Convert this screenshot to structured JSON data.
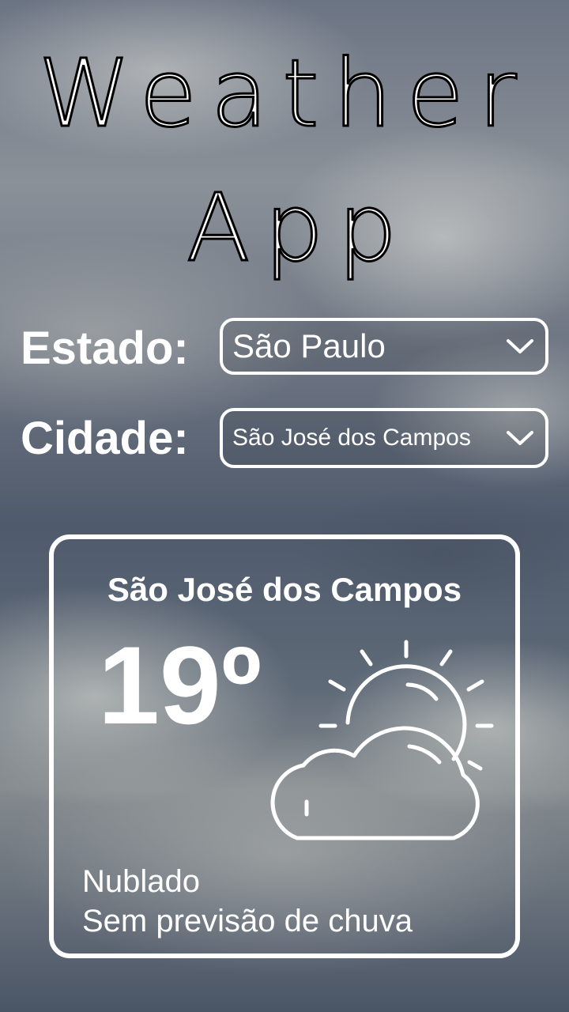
{
  "app": {
    "title_line1": "Weather",
    "title_line2": "App"
  },
  "form": {
    "estado_label": "Estado:",
    "estado_value": "São Paulo",
    "cidade_label": "Cidade:",
    "cidade_value": "São José dos Campos"
  },
  "weather": {
    "city": "São José dos Campos",
    "temperature": "19º",
    "condition": "Nublado",
    "rain": "Sem previsão de chuva",
    "icon": "partly-cloudy-icon"
  },
  "icons": {
    "dropdown": "chevron-down-icon"
  }
}
